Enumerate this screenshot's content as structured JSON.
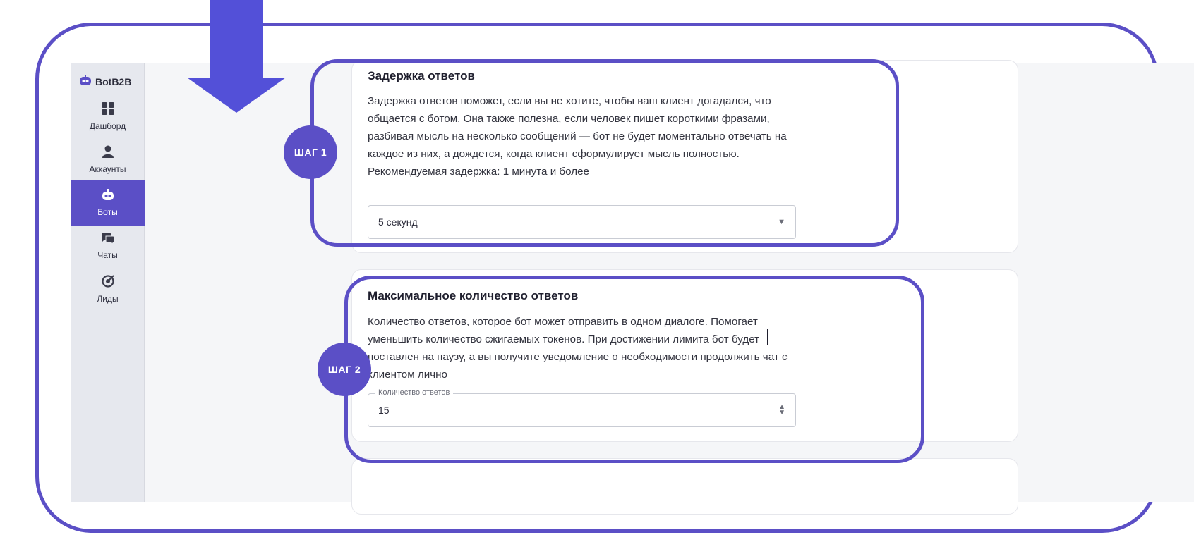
{
  "app": {
    "brand": "BotB2B",
    "nav": [
      {
        "label": "Дашборд",
        "icon": "dashboard-grid-icon"
      },
      {
        "label": "Аккаунты",
        "icon": "user-icon"
      },
      {
        "label": "Боты",
        "icon": "bot-icon",
        "active": true
      },
      {
        "label": "Чаты",
        "icon": "chat-bubbles-icon"
      },
      {
        "label": "Лиды",
        "icon": "target-icon"
      }
    ]
  },
  "delay_card": {
    "title": "Задержка ответов",
    "description": "Задержка ответов поможет, если вы не хотите, чтобы ваш клиент догадался, что общается с ботом. Она также полезна, если человек пишет короткими фразами, разбивая мысль на несколько сообщений — бот не будет моментально отвечать на каждое из них, а дождется, когда клиент сформулирует мысль полностью. Рекомендуемая задержка: 1 минута и более",
    "select_value": "5 секунд"
  },
  "max_card": {
    "title": "Максимальное количество ответов",
    "description": "Количество ответов, которое бот может отправить в одном диалоге. Помогает уменьшить количество сжигаемых токенов. При достижении лимита бот будет поставлен на паузу, а вы получите уведомление о необходимости продолжить чат с клиентом лично",
    "field_label": "Количество ответов",
    "field_value": "15"
  },
  "steps": {
    "step1": "ШАГ 1",
    "step2": "ШАГ 2"
  },
  "colors": {
    "accent": "#5b4fc6",
    "sidebar": "#e6e8ee",
    "background": "#f5f6f8"
  }
}
